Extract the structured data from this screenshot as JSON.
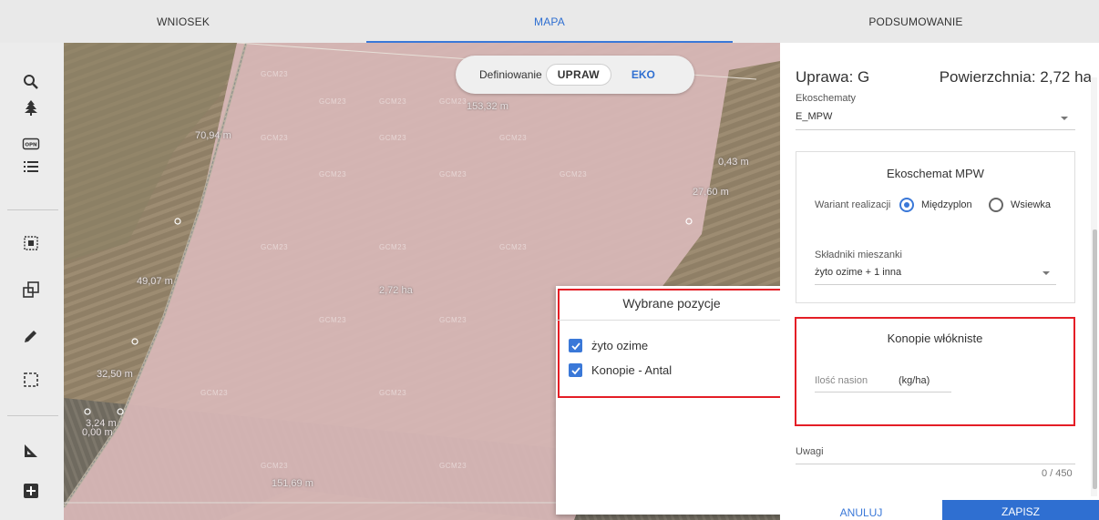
{
  "tabs": [
    {
      "label": "WNIOSEK",
      "active": false
    },
    {
      "label": "MAPA",
      "active": true
    },
    {
      "label": "PODSUMOWANIE",
      "active": false
    }
  ],
  "toolbar": {
    "tools": [
      "search-icon",
      "tree-icon",
      "opn-icon",
      "list-icon",
      "select-icon",
      "copy-icon",
      "pencil-icon",
      "rectangle-select-icon",
      "ruler-icon",
      "add-icon"
    ],
    "opn_text": "OPN"
  },
  "map": {
    "mode": {
      "label": "Definiowanie",
      "upraw": "UPRAW",
      "eko": "EKO"
    },
    "labels": {
      "top": "153,32 m",
      "left_top": "70,94 m",
      "right_a": "0,43 m",
      "right_b": "27,60 m",
      "left_mid": "49,07 m",
      "left_low": "32,50 m",
      "left_bottom_a": "3,24 m",
      "left_bottom_b": "0,00 m",
      "bottom": "151,69 m",
      "area": "2,72 ha"
    },
    "watermark": "GCM23"
  },
  "popup": {
    "title": "Wybrane pozycje",
    "items": [
      "żyto ozime",
      "Konopie - Antal"
    ]
  },
  "panel": {
    "crop_label": "Uprawa: G",
    "area_label": "Powierzchnia: 2,72 ha",
    "ekoschematy_label": "Ekoschematy",
    "ekoschematy_value": "E_MPW",
    "mpw_title": "Ekoschemat MPW",
    "wariant_label": "Wariant realizacji",
    "option1": "Międzyplon",
    "option2": "Wsiewka",
    "skladniki_label": "Składniki mieszanki",
    "skladniki_value": "żyto ozime + 1 inna",
    "konopie_title": "Konopie włókniste",
    "ilosc_placeholder": "Ilość nasion",
    "ilosc_unit": "(kg/ha)",
    "uwagi_label": "Uwagi",
    "uwagi_counter": "0 / 450",
    "cancel": "ANULUJ",
    "save": "ZAPISZ"
  },
  "colors": {
    "accent": "#2f6fd1",
    "highlight": "#e41e26",
    "parcel": "#d9b8b8"
  }
}
